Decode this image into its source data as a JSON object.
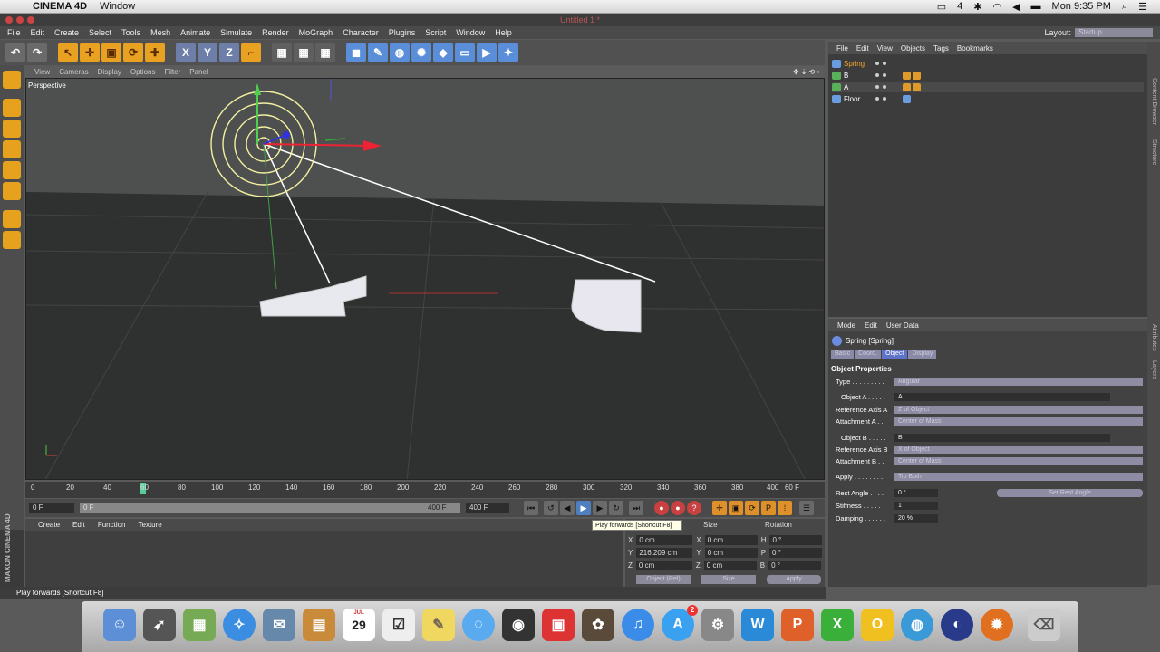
{
  "mac_menubar": {
    "app": "CINEMA 4D",
    "menu": [
      "Window"
    ],
    "clock": "Mon 9:35 PM",
    "status_num": "4"
  },
  "window_title": "Untitled 1 *",
  "app_menu": {
    "items": [
      "File",
      "Edit",
      "Create",
      "Select",
      "Tools",
      "Mesh",
      "Animate",
      "Simulate",
      "Render",
      "MoGraph",
      "Character",
      "Plugins",
      "Script",
      "Window",
      "Help"
    ],
    "layout_label": "Layout:",
    "layout_value": "Startup"
  },
  "viewport": {
    "menu": [
      "View",
      "Cameras",
      "Display",
      "Options",
      "Filter",
      "Panel"
    ],
    "label": "Perspective"
  },
  "timeline": {
    "ticks": [
      "0",
      "20",
      "40",
      "60",
      "80",
      "100",
      "120",
      "140",
      "160",
      "180",
      "200",
      "220",
      "240",
      "260",
      "280",
      "300",
      "320",
      "340",
      "360",
      "380",
      "400"
    ],
    "fps": "60 F",
    "start_frame": "0 F",
    "current_frame": "0 F",
    "end_frame": "400 F",
    "end_frame_2": "400 F"
  },
  "materials_menu": [
    "Create",
    "Edit",
    "Function",
    "Texture"
  ],
  "tooltip": "Play forwards [Shortcut F8]",
  "coords": {
    "headers": {
      "size": "Size",
      "rotation": "Rotation"
    },
    "rows": [
      {
        "axis": "X",
        "pos": "0 cm",
        "saxis": "X",
        "size": "0 cm",
        "raxis": "H",
        "rot": "0 °"
      },
      {
        "axis": "Y",
        "pos": "216.209 cm",
        "saxis": "Y",
        "size": "0 cm",
        "raxis": "P",
        "rot": "0 °"
      },
      {
        "axis": "Z",
        "pos": "0 cm",
        "saxis": "Z",
        "size": "0 cm",
        "raxis": "B",
        "rot": "0 °"
      }
    ],
    "mode": "Object (Rel)",
    "size_mode": "Size",
    "apply": "Apply"
  },
  "status_bar": "Play forwards [Shortcut F8]",
  "maxon": "MAXON CINEMA 4D",
  "object_manager": {
    "menu": [
      "File",
      "Edit",
      "View",
      "Objects",
      "Tags",
      "Bookmarks"
    ],
    "objects": [
      {
        "name": "Spring",
        "selected": true
      },
      {
        "name": "B",
        "selected": false
      },
      {
        "name": "A",
        "selected": false
      },
      {
        "name": "Floor",
        "selected": false
      }
    ]
  },
  "side_tabs": [
    "Content Browser",
    "Structure",
    "Attributes",
    "Layers"
  ],
  "attribute_manager": {
    "menu": [
      "Mode",
      "Edit",
      "User Data"
    ],
    "title": "Spring [Spring]",
    "tabs": [
      "Basic",
      "Coord.",
      "Object",
      "Display"
    ],
    "active_tab": "Object",
    "section": "Object Properties",
    "props": {
      "type_label": "Type . . . . . . . . .",
      "type_value": "Angular",
      "obja_label": "Object A . . . . .",
      "obja_value": "A",
      "refa_label": "Reference Axis A",
      "refa_value": "Z of Object",
      "atta_label": "Attachment A . .",
      "atta_value": "Center of Mass",
      "objb_label": "Object B . . . . .",
      "objb_value": "B",
      "refb_label": "Reference Axis B",
      "refb_value": "X of Object",
      "attb_label": "Attachment B . .",
      "attb_value": "Center of Mass",
      "apply_label": "Apply . . . . . . . .",
      "apply_value": "Tip Both",
      "rest_label": "Rest Angle . . . .",
      "rest_value": "0 °",
      "set_rest": "Set Rest Angle",
      "stiff_label": "Stiffness . . . . .",
      "stiff_value": "1",
      "damp_label": "Damping . . . . . .",
      "damp_value": "20 %"
    }
  },
  "dock": {
    "calendar_day": "29",
    "calendar_month": "JUL",
    "appstore_badge": "2"
  },
  "colors": {
    "accent_orange": "#e8a120",
    "active_tab": "#5f74c9",
    "spring_line": "#ffffff"
  }
}
